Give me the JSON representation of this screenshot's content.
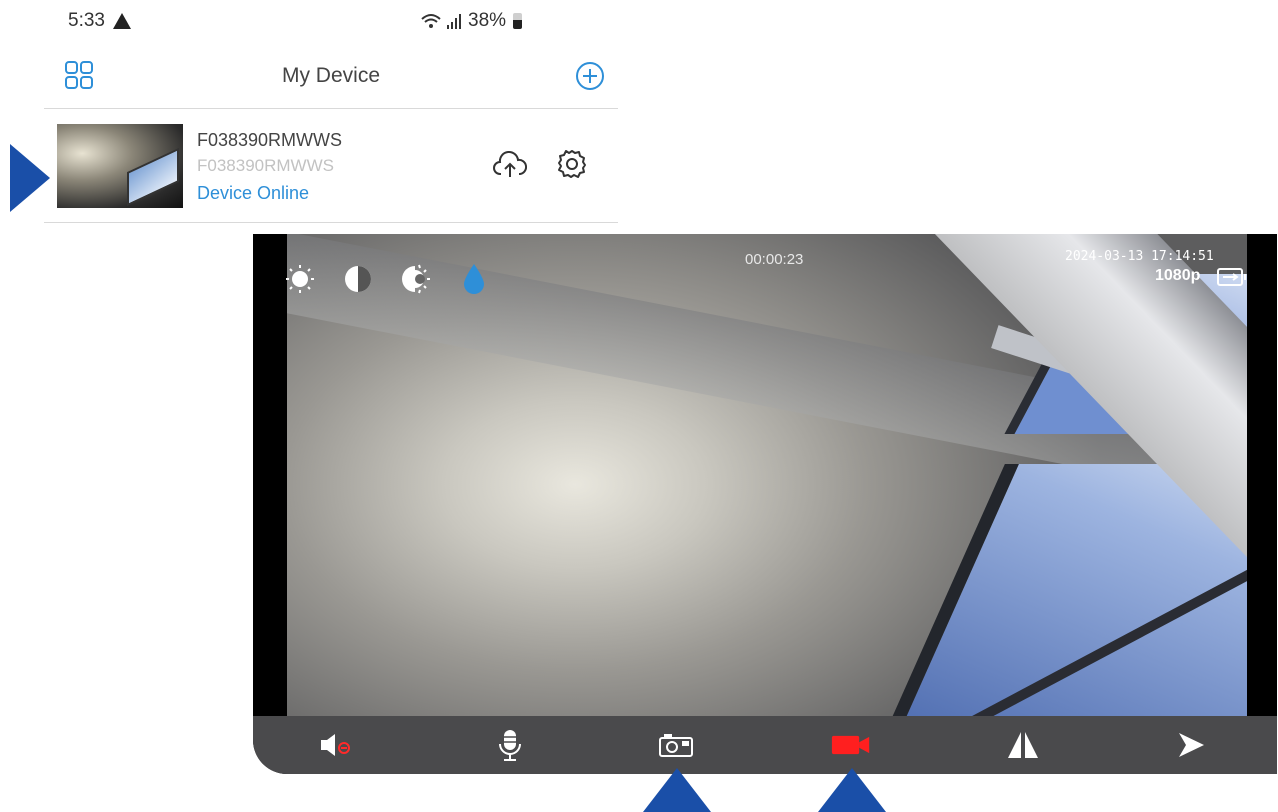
{
  "status_bar": {
    "time": "5:33",
    "battery": "38%"
  },
  "header": {
    "title": "My Device"
  },
  "device": {
    "name": "F038390RMWWS",
    "sub_id": "F038390RMWWS",
    "status": "Device Online"
  },
  "viewer": {
    "timer": "00:00:23",
    "datestamp": "2024-03-13 17:14:51",
    "resolution": "1080p",
    "image_controls": [
      "brightness-icon",
      "contrast-icon",
      "saturation-icon",
      "hue-icon"
    ],
    "controls": [
      "speaker-muted-icon",
      "microphone-icon",
      "snapshot-camera-icon",
      "record-video-icon",
      "flip-icon",
      "ptz-arrow-icon"
    ]
  },
  "colors": {
    "accent": "#2e8fd8",
    "record": "#ff1f1f",
    "pointer": "#1a4fa8",
    "control_bar": "#4a4a4c"
  }
}
